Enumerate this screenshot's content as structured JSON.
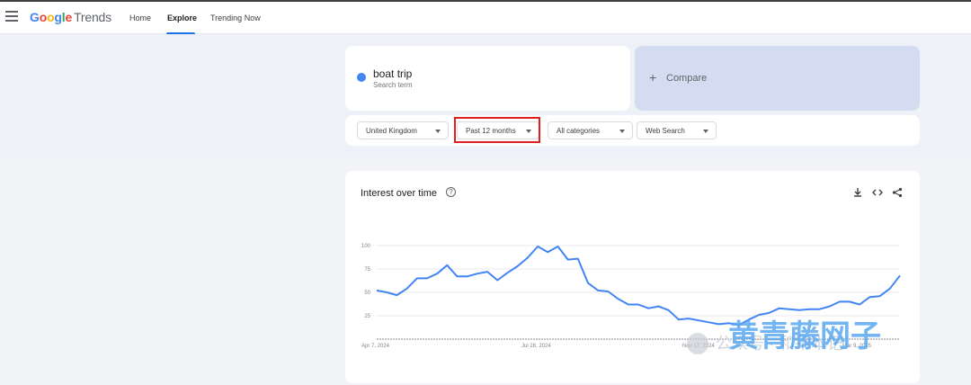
{
  "header": {
    "logo_google": "Google",
    "logo_trends": "Trends",
    "nav": [
      "Home",
      "Explore",
      "Trending Now"
    ],
    "active_nav": "Explore"
  },
  "search": {
    "term": "boat trip",
    "term_subtitle": "Search term",
    "term_color": "#4285f4",
    "compare_label": "Compare",
    "compare_icon": "plus-icon"
  },
  "filters": {
    "region": "United Kingdom",
    "time_range": "Past 12 months",
    "category": "All categories",
    "property": "Web Search"
  },
  "chart_card": {
    "title": "Interest over time",
    "tools": [
      "download-icon",
      "embed-code-icon",
      "share-icon"
    ]
  },
  "chart_data": {
    "type": "line",
    "title": "Interest over time",
    "ylim": [
      0,
      100
    ],
    "y_ticks": [
      25,
      50,
      75,
      100
    ],
    "x_tick_labels": [
      "Apr 7, 2024",
      "Jul 28, 2024",
      "Nov 17, 2024",
      "Mar 9, 2025"
    ],
    "grid": true,
    "series": [
      {
        "name": "boat trip",
        "color": "#4285f4",
        "values": [
          52,
          50,
          47,
          54,
          65,
          65,
          70,
          79,
          67,
          67,
          70,
          72,
          63,
          71,
          78,
          87,
          99,
          93,
          99,
          85,
          86,
          60,
          52,
          51,
          43,
          37,
          37,
          33,
          35,
          31,
          21,
          22,
          20,
          18,
          16,
          17,
          15,
          21,
          26,
          28,
          33,
          32,
          31,
          32,
          32,
          35,
          40,
          40,
          37,
          45,
          46,
          54,
          68
        ]
      }
    ]
  },
  "watermark": {
    "text": "公众号 · 和平本记",
    "logo_text": "黄青藤网子"
  }
}
